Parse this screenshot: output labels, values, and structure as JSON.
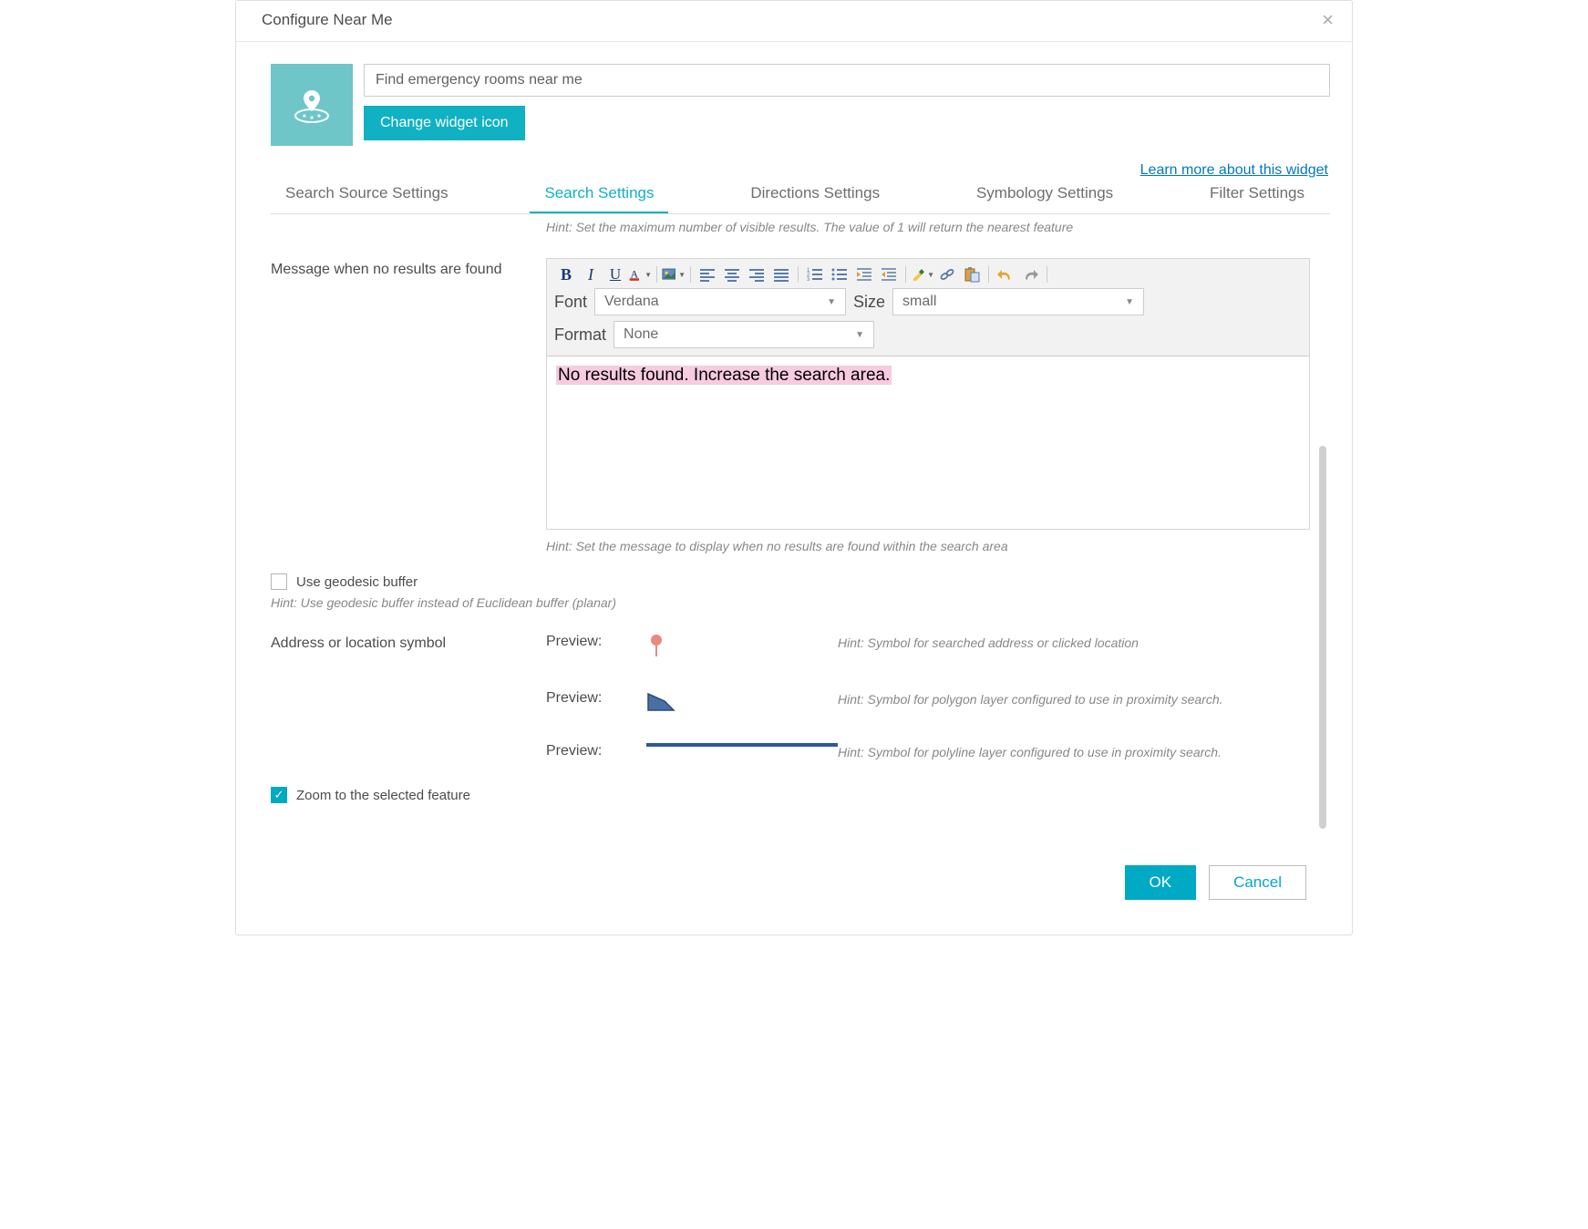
{
  "dialog": {
    "title": "Configure Near Me",
    "close_label": "×"
  },
  "widget": {
    "title_input": "Find emergency rooms near me",
    "change_icon": "Change widget icon",
    "learn_more": "Learn more about this widget"
  },
  "tabs": {
    "source": "Search Source Settings",
    "search": "Search Settings",
    "directions": "Directions Settings",
    "symbology": "Symbology Settings",
    "filter": "Filter Settings"
  },
  "hints": {
    "max_results": "Hint: Set the maximum number of visible results. The value of 1 will return the nearest feature",
    "no_results": "Hint: Set the message to display when no results are found within the search area",
    "geodesic": "Hint: Use geodesic buffer instead of Euclidean buffer (planar)",
    "sym_point": "Hint: Symbol for searched address or clicked location",
    "sym_poly": "Hint: Symbol for polygon layer configured to use in proximity search.",
    "sym_line": "Hint: Symbol for polyline layer configured to use in proximity search."
  },
  "labels": {
    "no_results_row": "Message when no results are found",
    "font": "Font",
    "size": "Size",
    "format": "Format",
    "geodesic": "Use geodesic buffer",
    "address_sym": "Address or location symbol",
    "preview": "Preview:",
    "zoom_selected": "Zoom to the selected feature"
  },
  "editor": {
    "font_value": "Verdana",
    "size_value": "small",
    "format_value": "None",
    "body_text": "No results found. Increase the search area."
  },
  "footer": {
    "ok": "OK",
    "cancel": "Cancel"
  }
}
